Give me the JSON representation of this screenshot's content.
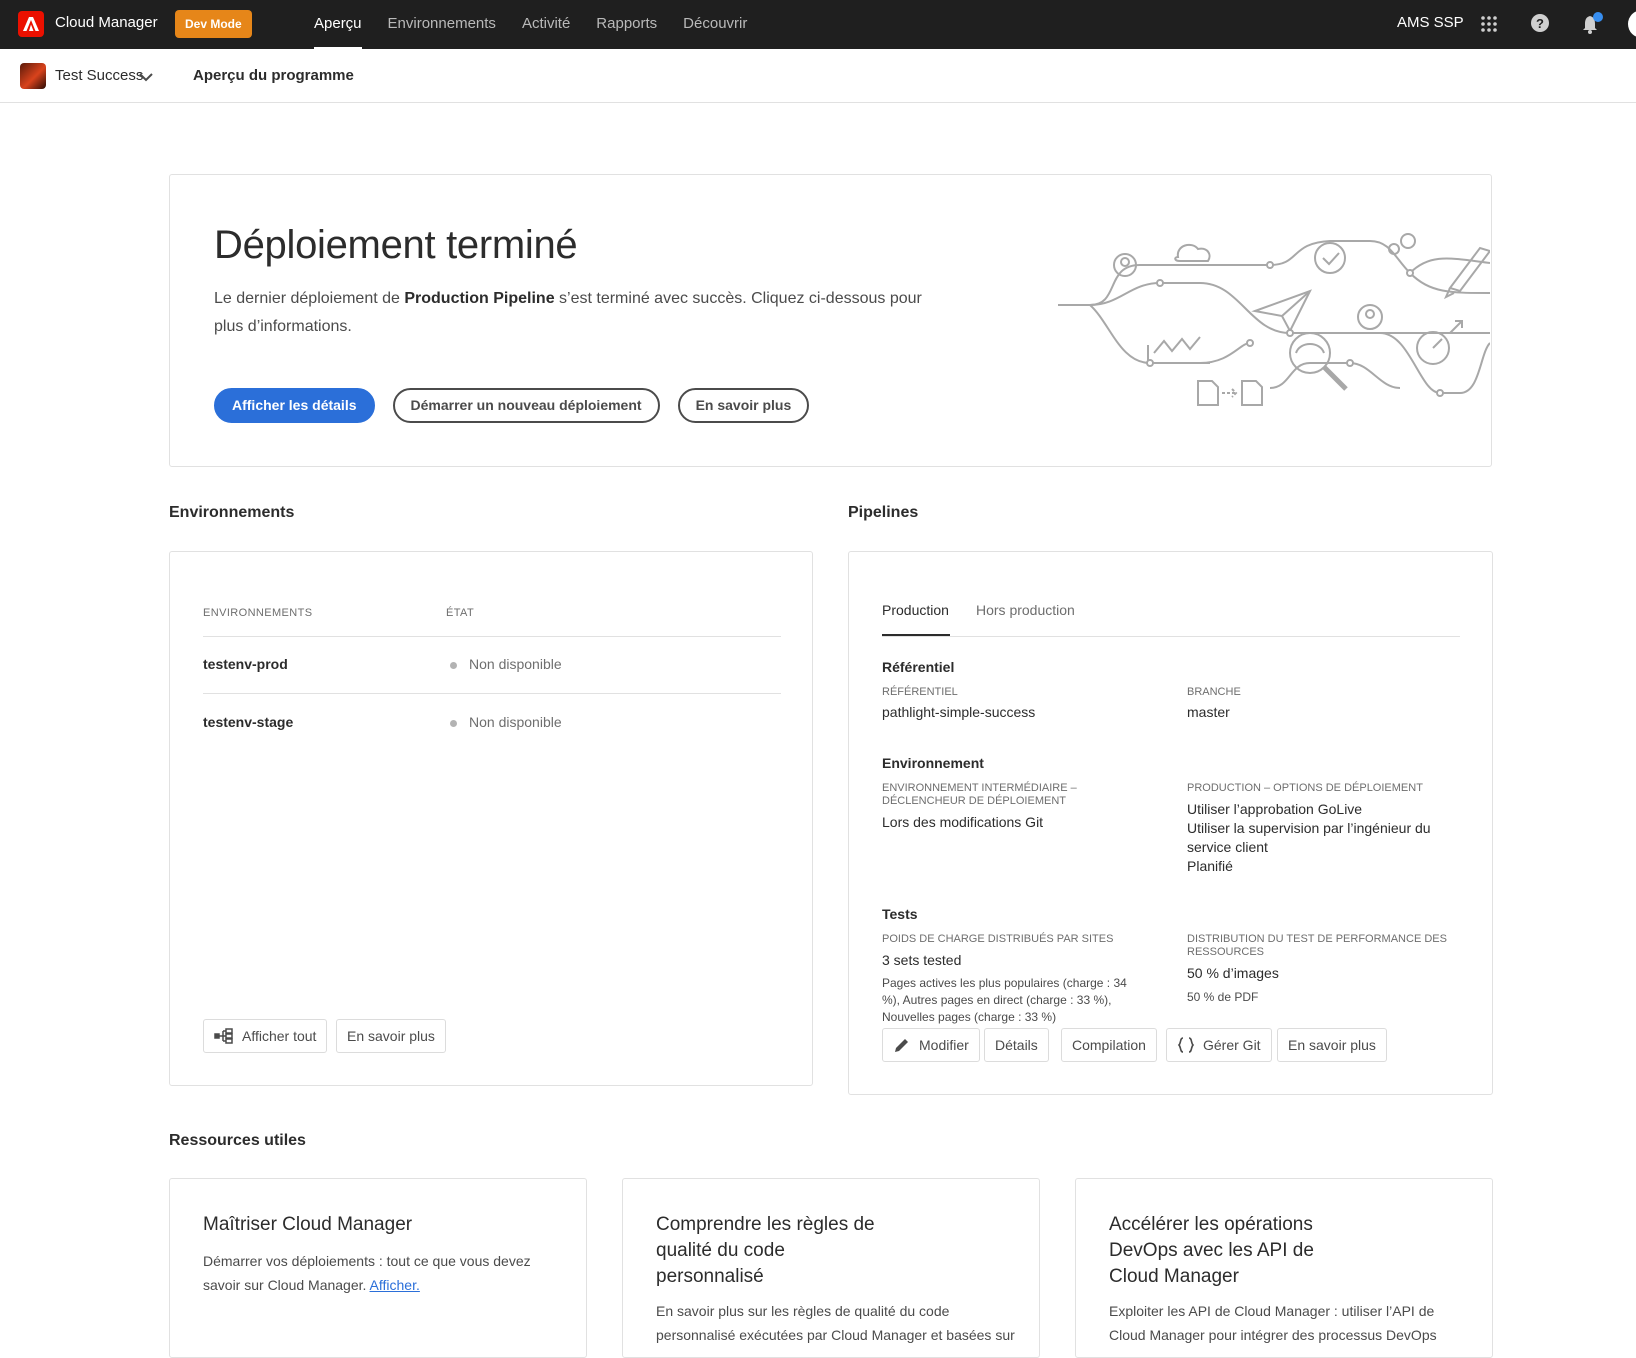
{
  "topbar": {
    "app_title": "Cloud Manager",
    "dev_mode": "Dev Mode",
    "nav": [
      {
        "label": "Aperçu",
        "active": true
      },
      {
        "label": "Environnements",
        "active": false
      },
      {
        "label": "Activité",
        "active": false
      },
      {
        "label": "Rapports",
        "active": false
      },
      {
        "label": "Découvrir",
        "active": false
      }
    ],
    "org": "AMS SSP"
  },
  "subbar": {
    "program": "Test Success",
    "title": "Aperçu du programme"
  },
  "hero": {
    "title": "Déploiement terminé",
    "desc_before": "Le dernier déploiement de ",
    "desc_bold": "Production Pipeline",
    "desc_after": " s’est terminé avec succès. Cliquez ci-dessous pour plus d’informations.",
    "btn_details": "Afficher les détails",
    "btn_new": "Démarrer un nouveau déploiement",
    "btn_learn": "En savoir plus"
  },
  "environments": {
    "section_title": "Environnements",
    "col_env": "ENVIRONNEMENTS",
    "col_state": "ÉTAT",
    "rows": [
      {
        "name": "testenv-prod",
        "status": "Non disponible"
      },
      {
        "name": "testenv-stage",
        "status": "Non disponible"
      }
    ],
    "btn_all": "Afficher tout",
    "btn_learn": "En savoir plus"
  },
  "pipelines": {
    "section_title": "Pipelines",
    "tabs": [
      "Production",
      "Hors production"
    ],
    "repo_head": "Référentiel",
    "repo_label": "RÉFÉRENTIEL",
    "repo_value": "pathlight-simple-success",
    "branch_label": "BRANCHE",
    "branch_value": "master",
    "env_head": "Environnement",
    "stage_label": "ENVIRONNEMENT INTERMÉDIAIRE – DÉCLENCHEUR DE DÉPLOIEMENT",
    "stage_value": "Lors des modifications Git",
    "prod_label": "PRODUCTION – OPTIONS DE DÉPLOIEMENT",
    "prod_values": [
      "Utiliser l’approbation GoLive",
      "Utiliser la supervision par l’ingénieur du service client",
      "Planifié"
    ],
    "tests_head": "Tests",
    "load_label": "POIDS DE CHARGE DISTRIBUÉS PAR SITES",
    "load_value": "3 sets tested",
    "load_detail": "Pages actives les plus populaires (charge : 34 %), Autres pages en direct (charge : 33 %), Nouvelles pages (charge : 33 %)",
    "perf_label": "DISTRIBUTION DU TEST DE PERFORMANCE DES RESSOURCES",
    "perf_value": "50 % d’images",
    "perf_detail": "50 % de PDF",
    "btn_edit": "Modifier",
    "btn_details": "Détails",
    "btn_build": "Compilation",
    "btn_git": "Gérer Git",
    "btn_learn": "En savoir plus"
  },
  "resources": {
    "section_title": "Ressources utiles",
    "cards": [
      {
        "title": "Maîtriser Cloud Manager",
        "text": "Démarrer vos déploiements : tout ce que vous devez savoir sur Cloud Manager.",
        "link": "Afficher."
      },
      {
        "title": "Comprendre les règles de qualité du code personnalisé",
        "text": "En savoir plus sur les règles de qualité du code personnalisé exécutées par Cloud Manager et basées sur"
      },
      {
        "title": "Accélérer les opérations DevOps avec les API de Cloud Manager",
        "text": "Exploiter les API de Cloud Manager : utiliser l’API de Cloud Manager pour intégrer des processus DevOps"
      }
    ]
  },
  "colors": {
    "accent": "#2b6fd9",
    "devmode": "#e68619",
    "adobe_red": "#eb1000",
    "topbar": "#1f1f1f"
  }
}
